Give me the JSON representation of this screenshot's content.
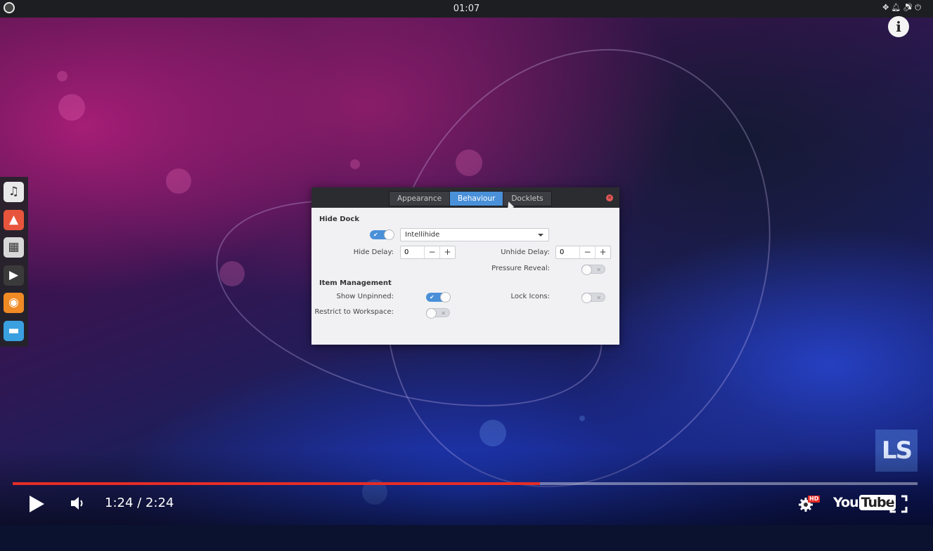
{
  "top_panel": {
    "clock": "01:07",
    "tray_icons": [
      "network-icon",
      "bell-icon",
      "volume-icon",
      "power-icon"
    ]
  },
  "dock": {
    "items": [
      {
        "name": "music-icon",
        "glyph": "♫",
        "color": "#e9e9e9"
      },
      {
        "name": "photos-icon",
        "glyph": "▲",
        "color": "#e8553d"
      },
      {
        "name": "calendar-icon",
        "glyph": "▦",
        "color": "#d8d8d8"
      },
      {
        "name": "video-icon",
        "glyph": "▶",
        "color": "#3a3a3a"
      },
      {
        "name": "firefox-icon",
        "glyph": "◉",
        "color": "#f08a24"
      },
      {
        "name": "desktop-icon",
        "glyph": "▬",
        "color": "#3aa0e0"
      }
    ]
  },
  "dialog": {
    "tabs": [
      {
        "label": "Appearance",
        "active": false
      },
      {
        "label": "Behaviour",
        "active": true
      },
      {
        "label": "Docklets",
        "active": false
      }
    ],
    "hide_dock": {
      "title": "Hide Dock",
      "enabled": true,
      "mode": "Intellihide",
      "hide_delay_label": "Hide Delay:",
      "hide_delay": "0",
      "unhide_delay_label": "Unhide Delay:",
      "unhide_delay": "0",
      "pressure_reveal_label": "Pressure Reveal:",
      "pressure_reveal": false
    },
    "item_management": {
      "title": "Item Management",
      "show_unpinned_label": "Show Unpinned:",
      "show_unpinned": true,
      "lock_icons_label": "Lock Icons:",
      "lock_icons": false,
      "restrict_label": "Restrict to Workspace:",
      "restrict": false
    }
  },
  "watermark": "LS",
  "player": {
    "current_time": "1:24",
    "duration": "2:24",
    "time_text": "1:24 / 2:24",
    "progress": 0.583,
    "hd_label": "HD",
    "youtube_you": "You",
    "youtube_tube": "Tube",
    "colors": {
      "progress": "#e52d27",
      "accent": "#4a90d9"
    }
  }
}
